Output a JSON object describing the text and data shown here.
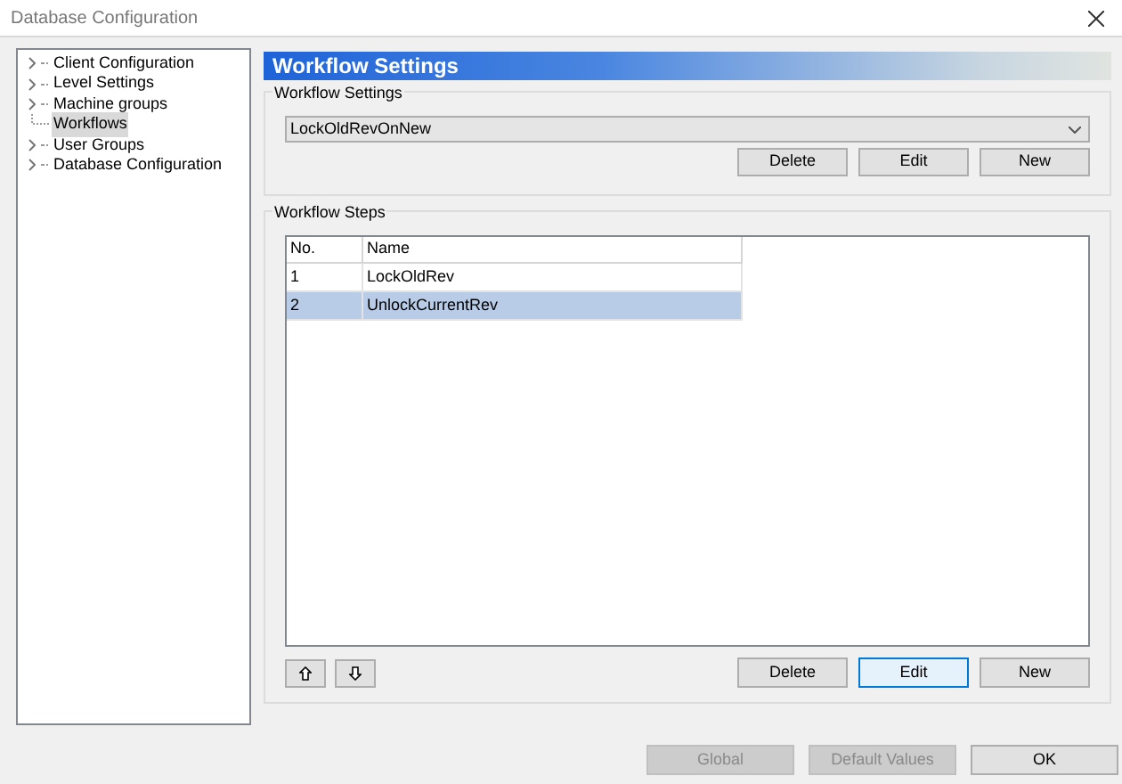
{
  "window": {
    "title": "Database Configuration"
  },
  "tree": [
    {
      "label": "Client Configuration",
      "expandable": true,
      "selected": false
    },
    {
      "label": "Level Settings",
      "expandable": true,
      "selected": false
    },
    {
      "label": "Machine groups",
      "expandable": true,
      "selected": false
    },
    {
      "label": "Workflows",
      "expandable": false,
      "selected": true
    },
    {
      "label": "User Groups",
      "expandable": true,
      "selected": false
    },
    {
      "label": "Database Configuration",
      "expandable": true,
      "selected": false
    }
  ],
  "header": "Workflow Settings",
  "workflow_settings": {
    "title": "Workflow Settings",
    "value": "LockOldRevOnNew",
    "buttons": [
      {
        "label": "Delete",
        "focused": false,
        "disabled": false
      },
      {
        "label": "Edit",
        "focused": false,
        "disabled": false
      },
      {
        "label": "New",
        "focused": false,
        "disabled": false
      }
    ]
  },
  "workflow_steps": {
    "title": "Workflow Steps",
    "columns": [
      "No.",
      "Name"
    ],
    "rows": [
      {
        "cells": [
          "1",
          "LockOldRev"
        ],
        "selected": false
      },
      {
        "cells": [
          "2",
          "UnlockCurrentRev"
        ],
        "selected": true
      }
    ],
    "buttons": [
      {
        "label": "Delete",
        "focused": false,
        "disabled": false
      },
      {
        "label": "Edit",
        "focused": true,
        "disabled": false
      },
      {
        "label": "New",
        "focused": false,
        "disabled": false
      }
    ]
  },
  "footer_buttons": [
    {
      "label": "Global",
      "focused": false,
      "disabled": true
    },
    {
      "label": "Default Values",
      "focused": false,
      "disabled": true
    },
    {
      "label": "OK",
      "focused": false,
      "disabled": false
    }
  ]
}
